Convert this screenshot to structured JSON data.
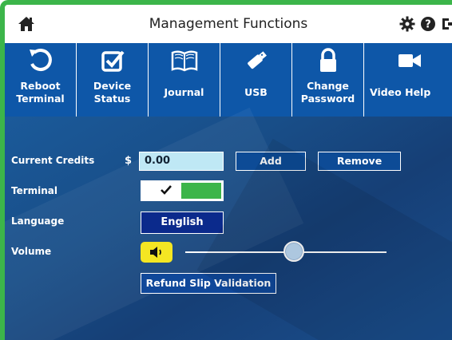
{
  "header": {
    "title": "Management Functions",
    "icons": [
      "home-icon",
      "gear-icon",
      "help-icon",
      "logout-icon"
    ]
  },
  "toolbar": {
    "items": [
      {
        "label": "Reboot\nTerminal",
        "icon": "reboot-icon"
      },
      {
        "label": "Device\nStatus",
        "icon": "checkbox-icon"
      },
      {
        "label": "Journal",
        "icon": "book-icon"
      },
      {
        "label": "USB",
        "icon": "usb-icon"
      },
      {
        "label": "Change\nPassword",
        "icon": "lock-icon"
      },
      {
        "label": "Video Help",
        "icon": "video-camera-icon"
      }
    ]
  },
  "form": {
    "credits_label": "Current Credits",
    "currency_symbol": "$",
    "credits_value": "0.00",
    "add_label": "Add",
    "remove_label": "Remove",
    "terminal_label": "Terminal",
    "terminal_enabled": true,
    "language_label": "Language",
    "language_value": "English",
    "volume_label": "Volume",
    "volume_level": 0.54,
    "refund_label": "Refund Slip Validation"
  },
  "colors": {
    "frame": "#3cb54a",
    "toolbar": "#0e57a8",
    "toggle_on": "#3cb54a",
    "mute_button": "#f4e623",
    "language_button": "#0b2a8c"
  }
}
